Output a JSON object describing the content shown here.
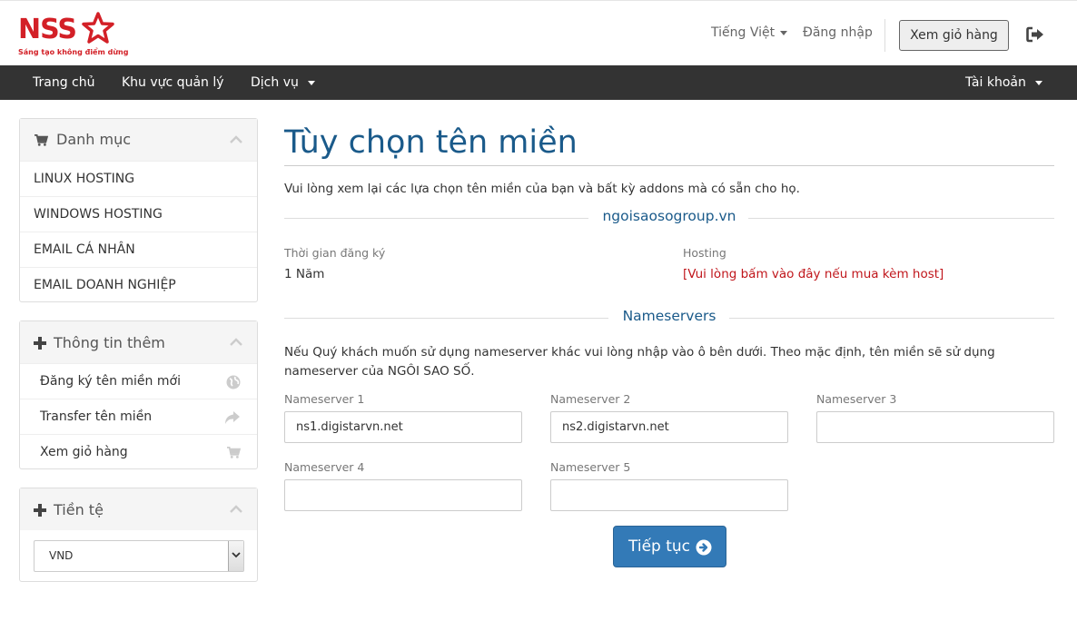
{
  "brand": {
    "name": "NSS",
    "tagline": "Sáng tạo không điểm dừng",
    "color": "#d32027"
  },
  "header": {
    "language": "Tiếng Việt",
    "login": "Đăng nhập",
    "cart_button": "Xem giỏ hàng",
    "logout_icon": "sign-out-icon"
  },
  "nav": {
    "home": "Trang chủ",
    "client_area": "Khu vực quản lý",
    "services": "Dịch vụ",
    "account": "Tài khoản"
  },
  "sidebar": {
    "categories": {
      "title": "Danh mục",
      "icon": "shopping-cart-icon",
      "items": [
        {
          "label": "LINUX HOSTING"
        },
        {
          "label": "WINDOWS HOSTING"
        },
        {
          "label": "EMAIL CÁ NHÂN"
        },
        {
          "label": "EMAIL DOANH NGHIỆP"
        }
      ]
    },
    "actions": {
      "title": "Thông tin thêm",
      "icon": "plus-icon",
      "items": [
        {
          "label": "Đăng ký tên miền mới",
          "icon": "globe-icon"
        },
        {
          "label": "Transfer tên miền",
          "icon": "share-icon"
        },
        {
          "label": "Xem giỏ hàng",
          "icon": "shopping-cart-icon"
        }
      ]
    },
    "currency": {
      "title": "Tiền tệ",
      "icon": "plus-icon",
      "selected": "VND"
    }
  },
  "main": {
    "title": "Tùy chọn tên miền",
    "intro": "Vui lòng xem lại các lựa chọn tên miền của bạn và bất kỳ addons mà có sẵn cho họ.",
    "domain": "ngoisaosogroup.vn",
    "reg_period_label": "Thời gian đăng ký",
    "reg_period_value": "1 Năm",
    "hosting_label": "Hosting",
    "hosting_link": "[Vui lòng bấm vào đây nếu mua kèm host]",
    "nameservers_heading": "Nameservers",
    "ns_note": "Nếu Quý khách muốn sử dụng nameserver khác vui lòng nhập vào ô bên dưới. Theo mặc định, tên miền sẽ sử dụng nameserver của NGÔI SAO SỐ.",
    "nameservers": [
      {
        "label": "Nameserver 1",
        "value": "ns1.digistarvn.net"
      },
      {
        "label": "Nameserver 2",
        "value": "ns2.digistarvn.net"
      },
      {
        "label": "Nameserver 3",
        "value": ""
      },
      {
        "label": "Nameserver 4",
        "value": ""
      },
      {
        "label": "Nameserver 5",
        "value": ""
      }
    ],
    "continue_button": "Tiếp tục",
    "accent_color": "#337ab7",
    "link_color": "#c0161b"
  }
}
